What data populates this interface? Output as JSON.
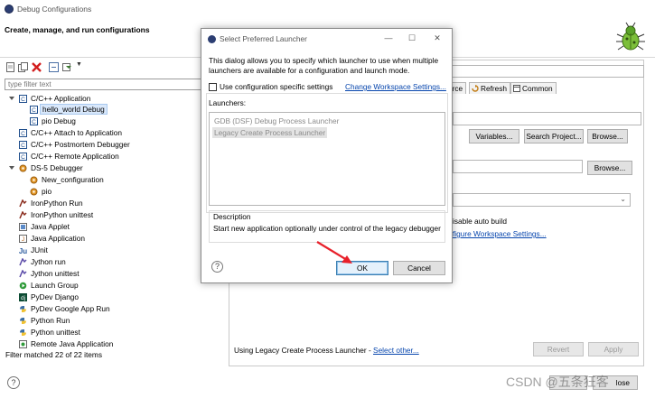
{
  "window": {
    "title": "Debug Configurations",
    "heading": "Create, manage, and run configurations"
  },
  "sidebar": {
    "filter_placeholder": "type filter text",
    "items": [
      {
        "label": "C/C++ Application",
        "icon": "cpp-app-icon",
        "expanded": true
      },
      {
        "label": "hello_world Debug",
        "icon": "cpp-config-icon",
        "selected": true
      },
      {
        "label": "pio Debug",
        "icon": "cpp-config-icon"
      },
      {
        "label": "C/C++ Attach to Application",
        "icon": "cpp-attach-icon"
      },
      {
        "label": "C/C++ Postmortem Debugger",
        "icon": "cpp-postmortem-icon"
      },
      {
        "label": "C/C++ Remote Application",
        "icon": "cpp-remote-icon"
      },
      {
        "label": "DS-5 Debugger",
        "icon": "ds5-icon",
        "expanded": true
      },
      {
        "label": "New_configuration",
        "icon": "ds5-config-icon"
      },
      {
        "label": "pio",
        "icon": "ds5-config-icon"
      },
      {
        "label": "IronPython Run",
        "icon": "ironpython-icon"
      },
      {
        "label": "IronPython unittest",
        "icon": "ironpython-icon"
      },
      {
        "label": "Java Applet",
        "icon": "java-applet-icon"
      },
      {
        "label": "Java Application",
        "icon": "java-app-icon"
      },
      {
        "label": "JUnit",
        "icon": "junit-icon"
      },
      {
        "label": "Jython run",
        "icon": "jython-icon"
      },
      {
        "label": "Jython unittest",
        "icon": "jython-icon"
      },
      {
        "label": "Launch Group",
        "icon": "launch-group-icon"
      },
      {
        "label": "PyDev Django",
        "icon": "django-icon"
      },
      {
        "label": "PyDev Google App Run",
        "icon": "python-icon"
      },
      {
        "label": "Python Run",
        "icon": "python-icon"
      },
      {
        "label": "Python unittest",
        "icon": "python-icon"
      },
      {
        "label": "Remote Java Application",
        "icon": "remote-java-icon"
      }
    ],
    "filter_status": "Filter matched 22 of 22 items"
  },
  "main": {
    "tabs": [
      {
        "label": "urce"
      },
      {
        "label": "Refresh"
      },
      {
        "label": "Common"
      }
    ],
    "variables_label": "Variables...",
    "search_project_label": "Search Project...",
    "browse_label": "Browse...",
    "browse2_label": "Browse...",
    "disable_auto_build": "isable auto build",
    "configure_ws_link": "figure Workspace Settings...",
    "launcher_status": "Using Legacy Create Process Launcher - ",
    "select_other_link": "Select other...",
    "revert_label": "Revert",
    "apply_label": "Apply"
  },
  "footer": {
    "close_label": "lose"
  },
  "dialog": {
    "title": "Select Preferred Launcher",
    "description": "This dialog allows you to specify which launcher to use when multiple launchers are available for a configuration and launch mode.",
    "checkbox_label": "Use configuration specific settings",
    "checkbox_checked": false,
    "workspace_link": "Change Workspace Settings...",
    "launchers_label": "Launchers:",
    "launchers": [
      {
        "label": "GDB (DSF) Debug Process Launcher",
        "selected": false
      },
      {
        "label": "Legacy Create Process Launcher",
        "selected": true
      }
    ],
    "description_label": "Description",
    "description_text": "Start new application optionally under control of the legacy debugger",
    "ok_label": "OK",
    "cancel_label": "Cancel"
  },
  "watermark": "CSDN @五条狂客",
  "colors": {
    "link": "#0645ad",
    "selection": "#d9e8fb",
    "arrow": "#e8202a"
  }
}
